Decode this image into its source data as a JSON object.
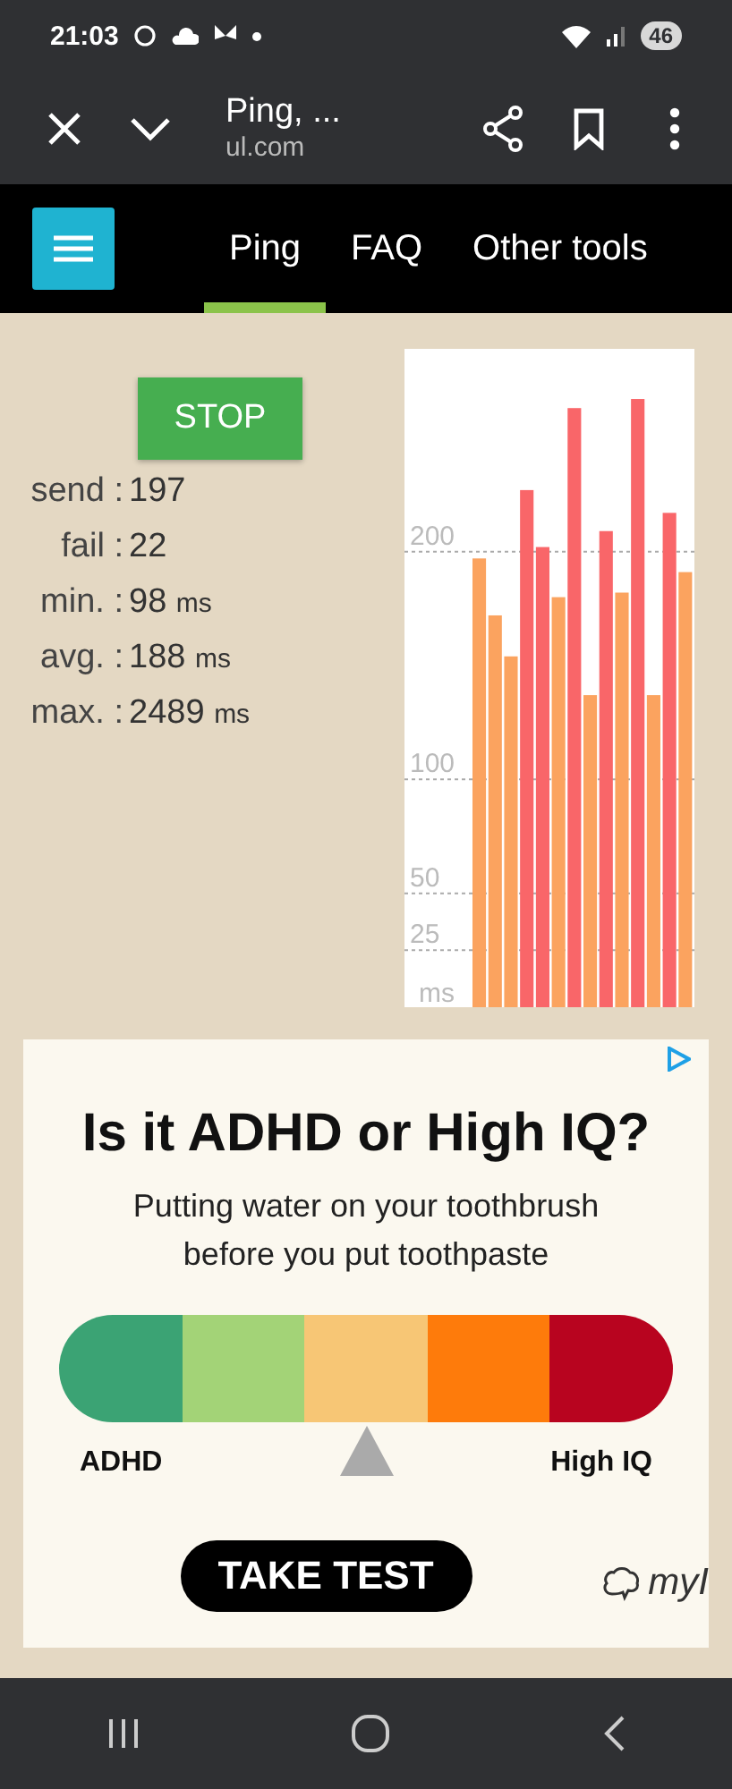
{
  "status_bar": {
    "time": "21:03",
    "battery": "46"
  },
  "browser_toolbar": {
    "title": "Ping, ...",
    "url": "ul.com"
  },
  "nav": {
    "tabs": [
      {
        "label": "Ping",
        "selected": true
      },
      {
        "label": "FAQ",
        "selected": false
      },
      {
        "label": "Other tools",
        "selected": false
      }
    ]
  },
  "controls": {
    "button": "STOP"
  },
  "stats": [
    {
      "label": "send :",
      "value": "197"
    },
    {
      "label": "fail :",
      "value": "22"
    },
    {
      "label": "min. :",
      "value": "98",
      "unit": "ms"
    },
    {
      "label": "avg. :",
      "value": "188",
      "unit": "ms"
    },
    {
      "label": "max. :",
      "value": "2489",
      "unit": "ms"
    }
  ],
  "chart": {
    "chart_data": {
      "type": "bar",
      "ylabel": "ms",
      "stacked": true,
      "grid": true,
      "ylim": [
        0,
        289
      ],
      "yticks": [
        25,
        50,
        100,
        200
      ],
      "series": [
        {
          "color": "#fba35f",
          "values": [
            197,
            172,
            154,
            null,
            null,
            180,
            null,
            137,
            null,
            182,
            null,
            137,
            null,
            191
          ]
        },
        {
          "color": "#f96669",
          "values": [
            null,
            null,
            null,
            227,
            202,
            null,
            263,
            null,
            209,
            null,
            267,
            null,
            217,
            null
          ]
        }
      ]
    }
  },
  "ad": {
    "title": "Is it ADHD or High IQ?",
    "subtitle": "Putting water on your toothbrush before you put toothpaste",
    "scale": {
      "segments": [
        {
          "color": "#3ba374"
        },
        {
          "color": "#a3d377"
        },
        {
          "color": "#f7c675"
        },
        {
          "color": "#fe7b0b"
        },
        {
          "color": "#b8041f"
        }
      ],
      "left_label": "ADHD",
      "right_label": "High IQ"
    },
    "button": "TAKE TEST",
    "brand": "myI"
  }
}
